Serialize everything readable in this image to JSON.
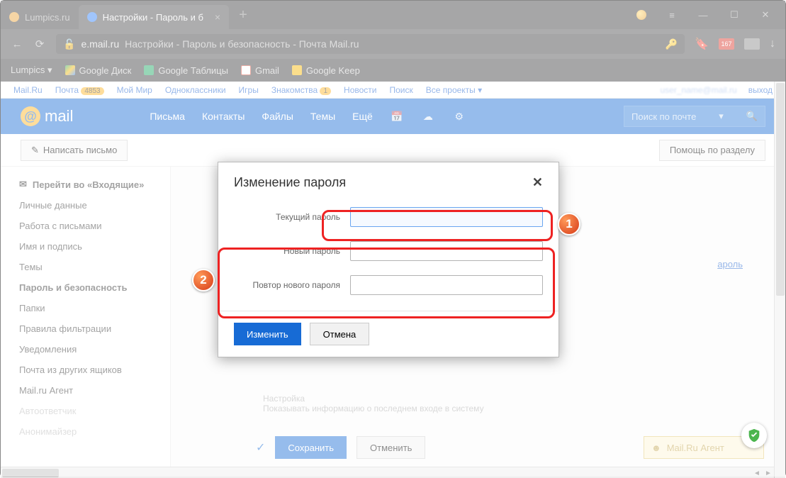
{
  "tabs": [
    {
      "label": "Lumpics.ru"
    },
    {
      "label": "Настройки - Пароль и б",
      "close": "×",
      "active": true
    }
  ],
  "tab_plus": "+",
  "winctrl": {
    "min": "—",
    "max": "☐",
    "close": "✕",
    "menu": "≡"
  },
  "addressbar": {
    "host": "e.mail.ru",
    "path": "Настройки - Пароль и безопасность - Почта Mail.ru",
    "badge": "167"
  },
  "bookmarks": [
    {
      "label": "Lumpics ▾",
      "color": ""
    },
    {
      "label": "Google Диск",
      "color": "#19a55f"
    },
    {
      "label": "Google Таблицы",
      "color": "#19a55f"
    },
    {
      "label": "Gmail",
      "color": "#d14836"
    },
    {
      "label": "Google Keep",
      "color": "#f7b500"
    }
  ],
  "topnav": {
    "items": [
      "Mail.Ru",
      "Почта",
      "Мой Мир",
      "Одноклассники",
      "Игры",
      "Знакомства",
      "Новости",
      "Поиск",
      "Все проекты ▾"
    ],
    "mail_count": "4853",
    "zn_count": "1",
    "user": "user_name@mail.ru",
    "exit": "выход"
  },
  "mailhdr": {
    "logo": "mail",
    "nav": [
      "Письма",
      "Контакты",
      "Файлы",
      "Темы",
      "Ещё"
    ],
    "search_placeholder": "Поиск по почте"
  },
  "row2": {
    "compose": "Написать письмо",
    "help": "Помощь по разделу"
  },
  "sidebar": [
    "Перейти во «Входящие»",
    "Личные данные",
    "Работа с письмами",
    "Имя и подпись",
    "Темы",
    "Пароль и безопасность",
    "Папки",
    "Правила фильтрации",
    "Уведомления",
    "Почта из других ящиков",
    "Mail.ru Агент",
    "Автоответчик",
    "Анонимайзер"
  ],
  "panel": {
    "link": "ароль",
    "undertext1": "Настройка",
    "undertext2": "Показывать информацию о последнем входе в систему",
    "save": "Сохранить",
    "cancel": "Отменить",
    "agent": "Mail.Ru Агент"
  },
  "modal": {
    "title": "Изменение пароля",
    "close": "✕",
    "f1": "Текущий пароль",
    "f2": "Новый пароль",
    "f3": "Повтор нового пароля",
    "submit": "Изменить",
    "cancel": "Отмена"
  },
  "marker": {
    "n1": "1",
    "n2": "2"
  }
}
